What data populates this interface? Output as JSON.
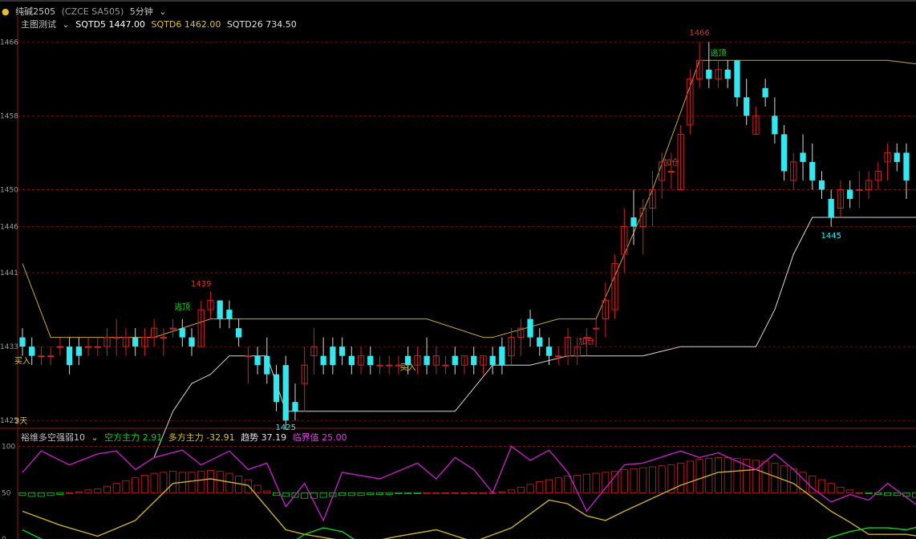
{
  "header": {
    "instrument": "纯碱2505",
    "exchange_code": "(CZCE SA505)",
    "period": "5分钟",
    "main_indicator": "主图测试",
    "sqtd5": "SQTD5 1447.00",
    "sqtd6": "SQTD6 1462.00",
    "sqtd26": "SQTD26 734.50"
  },
  "sub_header": {
    "indicator_name": "裕维多空强弱10",
    "short_force": "空方主力 2.91",
    "long_force": "多方主力 -32.91",
    "trend": "趋势 37.19",
    "warning": "临界值 25.00"
  },
  "colors": {
    "up": "#d02020",
    "down": "#30e8ee",
    "line_yellow": "#c8a83a",
    "line_white": "#d8d8d8",
    "magenta": "#c020c0",
    "green": "#10d020",
    "grid": "#7a1414",
    "axis_text": "#9a9a9a"
  },
  "chart_data": [
    {
      "type": "candlestick",
      "title": "",
      "y_ticks": [
        1425,
        1433,
        1441,
        1446,
        1450,
        1458,
        1466
      ],
      "y_range": [
        1424.5,
        1467.5
      ],
      "annotations": [
        {
          "text": "1466",
          "bar": 72,
          "price": 1466.2,
          "color": "#e03030",
          "pos": "above"
        },
        {
          "text": "1439",
          "bar": 19,
          "price": 1439.0,
          "color": "#e03030",
          "pos": "above"
        },
        {
          "text": "1425",
          "bar": 28,
          "price": 1425.0,
          "color": "#30e8ee",
          "pos": "below"
        },
        {
          "text": "1445",
          "bar": 86,
          "price": 1445.8,
          "color": "#30e8ee",
          "pos": "below"
        },
        {
          "text": "逃顶",
          "bar": 17,
          "price": 1436.5,
          "color": "#10d020",
          "pos": "above"
        },
        {
          "text": "逃顶",
          "bar": 74,
          "price": 1464.0,
          "color": "#10d020",
          "pos": "above"
        },
        {
          "text": "买入",
          "bar": 41,
          "price": 1431.5,
          "color": "#e0c030",
          "pos": "below"
        },
        {
          "text": "加仓",
          "bar": 60,
          "price": 1434.3,
          "color": "#e03030",
          "pos": "below"
        },
        {
          "text": "加仓",
          "bar": 69,
          "price": 1453.7,
          "color": "#e03030",
          "pos": "below"
        },
        {
          "text": "买入",
          "bar": 0,
          "price": 1431.5,
          "color": "#e0c030",
          "pos": "left"
        },
        {
          "text": "3天",
          "bar": 0,
          "price": 1425.0,
          "color": "#e0c030",
          "pos": "left"
        }
      ],
      "candles": [
        [
          1434,
          1435,
          1432,
          1433
        ],
        [
          1433,
          1434,
          1431,
          1432
        ],
        [
          1432,
          1433,
          1431,
          1432
        ],
        [
          1432,
          1433,
          1431,
          1432
        ],
        [
          1433,
          1434,
          1432,
          1433
        ],
        [
          1433,
          1434,
          1430,
          1431
        ],
        [
          1433,
          1434,
          1431,
          1432
        ],
        [
          1433,
          1434,
          1432,
          1433
        ],
        [
          1433,
          1434,
          1432,
          1433
        ],
        [
          1433,
          1435,
          1432,
          1434
        ],
        [
          1434,
          1436,
          1432,
          1434
        ],
        [
          1433,
          1435,
          1432,
          1434
        ],
        [
          1434,
          1435,
          1432,
          1433
        ],
        [
          1433,
          1435,
          1432,
          1434
        ],
        [
          1434,
          1436,
          1433,
          1435
        ],
        [
          1434,
          1435,
          1432,
          1434
        ],
        [
          1435,
          1436,
          1434,
          1435
        ],
        [
          1435,
          1436,
          1433,
          1434
        ],
        [
          1434,
          1435,
          1432,
          1433
        ],
        [
          1433,
          1438,
          1433,
          1437
        ],
        [
          1437,
          1439,
          1436,
          1438
        ],
        [
          1438,
          1438,
          1435,
          1436
        ],
        [
          1437,
          1438,
          1435,
          1436
        ],
        [
          1435,
          1436,
          1433,
          1434
        ],
        [
          1432,
          1433,
          1429,
          1432
        ],
        [
          1432,
          1433,
          1430,
          1431
        ],
        [
          1432,
          1434,
          1429,
          1430
        ],
        [
          1430,
          1431,
          1426,
          1427
        ],
        [
          1431,
          1432,
          1424,
          1425
        ],
        [
          1427,
          1429,
          1425,
          1426
        ],
        [
          1429,
          1433,
          1426,
          1431
        ],
        [
          1432,
          1435,
          1430,
          1433
        ],
        [
          1432,
          1434,
          1430,
          1431
        ],
        [
          1433,
          1434,
          1430,
          1431
        ],
        [
          1433,
          1434,
          1431,
          1432
        ],
        [
          1432,
          1433,
          1430,
          1431
        ],
        [
          1431,
          1433,
          1430,
          1432
        ],
        [
          1432,
          1433,
          1430,
          1431
        ],
        [
          1431,
          1432,
          1430,
          1431
        ],
        [
          1431,
          1432,
          1430,
          1431
        ],
        [
          1431,
          1432,
          1430,
          1431
        ],
        [
          1432,
          1433,
          1430,
          1431
        ],
        [
          1431,
          1433,
          1430,
          1432
        ],
        [
          1432,
          1434,
          1430,
          1431
        ],
        [
          1431,
          1433,
          1430,
          1432
        ],
        [
          1431,
          1432,
          1430,
          1431
        ],
        [
          1432,
          1433,
          1430,
          1431
        ],
        [
          1431,
          1432,
          1430,
          1432
        ],
        [
          1432,
          1433,
          1430,
          1431
        ],
        [
          1431,
          1432,
          1430,
          1432
        ],
        [
          1432,
          1433,
          1430,
          1431
        ],
        [
          1433,
          1434,
          1430,
          1431
        ],
        [
          1432,
          1435,
          1431,
          1434
        ],
        [
          1434,
          1436,
          1432,
          1435
        ],
        [
          1436,
          1437,
          1433,
          1434
        ],
        [
          1434,
          1435,
          1432,
          1433
        ],
        [
          1433,
          1434,
          1431,
          1432
        ],
        [
          1432,
          1433,
          1431,
          1432
        ],
        [
          1432,
          1435,
          1431,
          1434
        ],
        [
          1432,
          1434,
          1431,
          1433
        ],
        [
          1434,
          1435,
          1432,
          1434
        ],
        [
          1435,
          1436,
          1433,
          1435
        ],
        [
          1436,
          1440,
          1434,
          1438
        ],
        [
          1437,
          1443,
          1436,
          1442
        ],
        [
          1443,
          1448,
          1441,
          1446
        ],
        [
          1447,
          1450,
          1444,
          1446
        ],
        [
          1446,
          1449,
          1443,
          1448
        ],
        [
          1448,
          1452,
          1446,
          1450
        ],
        [
          1451,
          1454,
          1449,
          1453
        ],
        [
          1452,
          1454,
          1450,
          1452
        ],
        [
          1450,
          1457,
          1450,
          1456
        ],
        [
          1457,
          1463,
          1456,
          1462
        ],
        [
          1462,
          1466,
          1461,
          1464
        ],
        [
          1463,
          1466,
          1461,
          1462
        ],
        [
          1462,
          1464,
          1461,
          1463
        ],
        [
          1463,
          1464,
          1461,
          1462
        ],
        [
          1464,
          1464,
          1459,
          1460
        ],
        [
          1460,
          1462,
          1457,
          1458
        ],
        [
          1456,
          1459,
          1456,
          1458
        ],
        [
          1461,
          1462,
          1459,
          1460
        ],
        [
          1458,
          1460,
          1455,
          1456
        ],
        [
          1456,
          1457,
          1451,
          1452
        ],
        [
          1451,
          1454,
          1450,
          1453
        ],
        [
          1454,
          1456,
          1451,
          1453
        ],
        [
          1453,
          1455,
          1450,
          1451
        ],
        [
          1451,
          1452,
          1449,
          1450
        ],
        [
          1449,
          1450,
          1446,
          1447
        ],
        [
          1448,
          1451,
          1447,
          1450
        ],
        [
          1450,
          1451,
          1448,
          1449
        ],
        [
          1450,
          1452,
          1448,
          1450
        ],
        [
          1450,
          1452,
          1449,
          1451
        ],
        [
          1451,
          1453,
          1450,
          1452
        ],
        [
          1453,
          1455,
          1451,
          1454
        ],
        [
          1454,
          1455,
          1452,
          1453
        ],
        [
          1454,
          1455,
          1449,
          1451
        ]
      ],
      "series": [
        {
          "name": "",
          "color": "#c8a83a",
          "x": [
            0,
            3,
            8,
            14,
            20,
            30,
            39,
            43,
            49,
            50,
            57,
            61,
            67,
            72,
            80,
            92,
            96
          ],
          "y": [
            1442,
            1434,
            1434,
            1434,
            1436,
            1436,
            1436,
            1436,
            1434,
            1434,
            1436,
            1436,
            1450,
            1464,
            1464,
            1464,
            1463.5
          ]
        },
        {
          "name": "",
          "color": "#d8d8d8",
          "x": [
            14,
            16,
            18,
            20,
            22,
            24,
            26,
            28,
            30,
            34,
            38,
            42,
            46,
            50,
            54,
            58,
            62,
            66,
            68,
            70,
            74,
            78,
            80,
            82,
            84,
            86,
            88,
            90,
            96
          ],
          "y": [
            1421,
            1426,
            1429,
            1430,
            1432,
            1432,
            1432,
            1426,
            1426,
            1426,
            1426,
            1426,
            1426,
            1431,
            1431,
            1432,
            1432,
            1432,
            1432.5,
            1433,
            1433,
            1433,
            1437,
            1443,
            1447,
            1447,
            1447,
            1447,
            1447
          ]
        }
      ]
    },
    {
      "type": "bar",
      "title": "",
      "y_ticks": [
        0,
        50,
        100
      ],
      "y_range": [
        0,
        110
      ],
      "baseline": 50,
      "values": [
        47,
        46,
        46,
        47,
        48,
        50,
        51,
        53,
        54,
        57,
        60,
        63,
        66,
        69,
        71,
        72,
        73,
        72,
        72,
        73,
        74,
        73,
        71,
        68,
        64,
        58,
        52,
        47,
        46,
        45,
        44,
        44,
        45,
        46,
        47,
        47,
        47,
        48,
        48,
        48,
        49,
        49,
        49,
        50,
        50,
        50,
        50,
        50,
        50,
        50,
        50,
        51,
        53,
        56,
        59,
        62,
        64,
        66,
        68,
        69,
        70,
        71,
        72,
        73,
        75,
        76,
        77,
        78,
        79,
        80,
        82,
        84,
        86,
        87,
        88,
        88,
        87,
        86,
        85,
        84,
        82,
        79,
        76,
        72,
        68,
        64,
        60,
        56,
        53,
        50,
        49,
        48,
        47,
        47,
        46,
        45,
        47
      ],
      "series": [
        {
          "name": "",
          "color": "#c8b030",
          "x": [
            0,
            4,
            8,
            12,
            16,
            20,
            24,
            28,
            30,
            36,
            40,
            44,
            48,
            52,
            56,
            58,
            60,
            62,
            64,
            70,
            74,
            78,
            82,
            84,
            86,
            88,
            90,
            94,
            96
          ],
          "y": [
            30,
            15,
            3,
            20,
            60,
            65,
            58,
            10,
            5,
            -5,
            3,
            10,
            -3,
            12,
            42,
            38,
            25,
            20,
            30,
            58,
            72,
            75,
            60,
            45,
            30,
            18,
            5,
            5,
            2
          ]
        },
        {
          "name": "",
          "color": "#c020c0",
          "x": [
            0,
            2,
            5,
            8,
            10,
            12,
            14,
            17,
            19,
            22,
            24,
            26,
            28,
            30,
            32,
            34,
            38,
            42,
            44,
            46,
            48,
            50,
            52,
            54,
            56,
            58,
            60,
            64,
            66,
            70,
            72,
            74,
            78,
            80,
            82,
            84,
            86,
            88,
            90,
            92,
            94,
            96
          ],
          "y": [
            72,
            95,
            80,
            92,
            95,
            75,
            88,
            96,
            80,
            95,
            75,
            82,
            35,
            60,
            20,
            72,
            65,
            82,
            65,
            88,
            75,
            50,
            100,
            85,
            96,
            72,
            30,
            80,
            82,
            95,
            88,
            93,
            75,
            92,
            75,
            55,
            40,
            48,
            42,
            60,
            45,
            30
          ]
        },
        {
          "name": "",
          "color": "#10d020",
          "x": [
            0,
            3,
            5,
            8,
            12,
            16,
            20,
            24,
            28,
            30,
            32,
            34,
            36,
            38,
            40,
            44,
            50,
            56,
            60,
            64,
            68,
            72,
            76,
            80,
            82,
            84,
            86,
            88,
            90,
            92,
            94,
            96
          ],
          "y": [
            10,
            -5,
            -10,
            -15,
            -15,
            -15,
            -15,
            -15,
            -8,
            5,
            12,
            8,
            -5,
            -10,
            -15,
            -15,
            -15,
            -15,
            -15,
            -15,
            -15,
            -15,
            -15,
            -15,
            -12,
            -8,
            2,
            8,
            12,
            12,
            10,
            15
          ]
        }
      ]
    }
  ]
}
